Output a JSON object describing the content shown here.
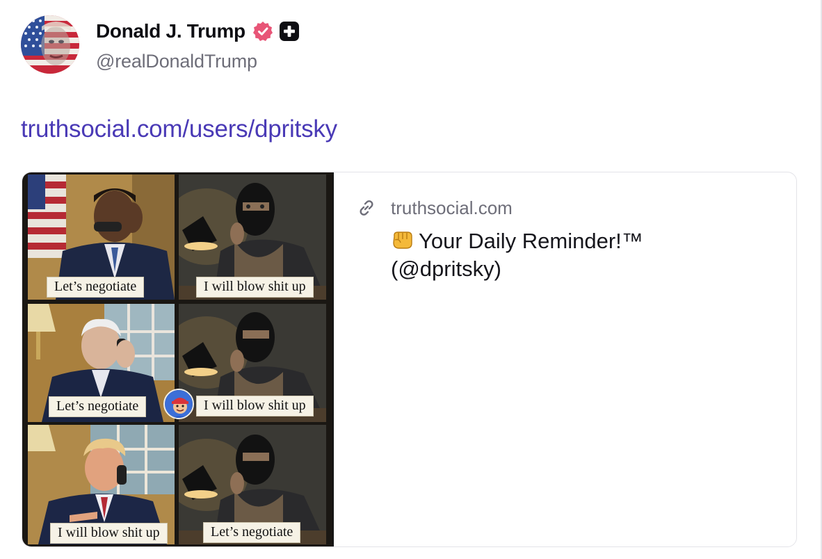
{
  "author": {
    "display_name": "Donald J. Trump",
    "handle": "@realDonaldTrump",
    "avatar_icon": "avatar-flag-portrait",
    "verified_icon": "verified-badge-icon",
    "badge_icon": "plus-badge-icon",
    "verified_color": "#e85577"
  },
  "post": {
    "link_text": "truthsocial.com/users/dpritsky",
    "link_color": "#4a3ab6"
  },
  "card": {
    "domain_icon": "link-icon",
    "domain": "truthsocial.com",
    "title_emoji_icon": "oncoming-fist-icon",
    "title": "Your Daily Reminder!™ (@dpritsky)",
    "image": {
      "captions": [
        {
          "row": 1,
          "left": "Let’s negotiate",
          "right": "I will blow shit up"
        },
        {
          "row": 2,
          "left": "Let’s negotiate",
          "right": "I will blow shit up"
        },
        {
          "row": 3,
          "left": "I will blow shit up",
          "right": "Let’s negotiate"
        }
      ]
    }
  }
}
